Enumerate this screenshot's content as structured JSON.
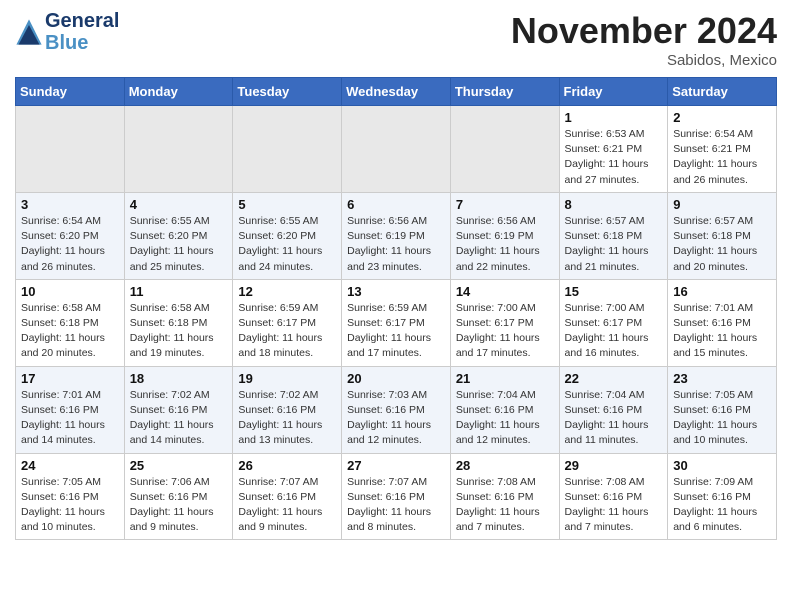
{
  "header": {
    "logo_line1": "General",
    "logo_line2": "Blue",
    "month": "November 2024",
    "location": "Sabidos, Mexico"
  },
  "weekdays": [
    "Sunday",
    "Monday",
    "Tuesday",
    "Wednesday",
    "Thursday",
    "Friday",
    "Saturday"
  ],
  "rows": [
    [
      {
        "day": "",
        "info": ""
      },
      {
        "day": "",
        "info": ""
      },
      {
        "day": "",
        "info": ""
      },
      {
        "day": "",
        "info": ""
      },
      {
        "day": "",
        "info": ""
      },
      {
        "day": "1",
        "info": "Sunrise: 6:53 AM\nSunset: 6:21 PM\nDaylight: 11 hours\nand 27 minutes."
      },
      {
        "day": "2",
        "info": "Sunrise: 6:54 AM\nSunset: 6:21 PM\nDaylight: 11 hours\nand 26 minutes."
      }
    ],
    [
      {
        "day": "3",
        "info": "Sunrise: 6:54 AM\nSunset: 6:20 PM\nDaylight: 11 hours\nand 26 minutes."
      },
      {
        "day": "4",
        "info": "Sunrise: 6:55 AM\nSunset: 6:20 PM\nDaylight: 11 hours\nand 25 minutes."
      },
      {
        "day": "5",
        "info": "Sunrise: 6:55 AM\nSunset: 6:20 PM\nDaylight: 11 hours\nand 24 minutes."
      },
      {
        "day": "6",
        "info": "Sunrise: 6:56 AM\nSunset: 6:19 PM\nDaylight: 11 hours\nand 23 minutes."
      },
      {
        "day": "7",
        "info": "Sunrise: 6:56 AM\nSunset: 6:19 PM\nDaylight: 11 hours\nand 22 minutes."
      },
      {
        "day": "8",
        "info": "Sunrise: 6:57 AM\nSunset: 6:18 PM\nDaylight: 11 hours\nand 21 minutes."
      },
      {
        "day": "9",
        "info": "Sunrise: 6:57 AM\nSunset: 6:18 PM\nDaylight: 11 hours\nand 20 minutes."
      }
    ],
    [
      {
        "day": "10",
        "info": "Sunrise: 6:58 AM\nSunset: 6:18 PM\nDaylight: 11 hours\nand 20 minutes."
      },
      {
        "day": "11",
        "info": "Sunrise: 6:58 AM\nSunset: 6:18 PM\nDaylight: 11 hours\nand 19 minutes."
      },
      {
        "day": "12",
        "info": "Sunrise: 6:59 AM\nSunset: 6:17 PM\nDaylight: 11 hours\nand 18 minutes."
      },
      {
        "day": "13",
        "info": "Sunrise: 6:59 AM\nSunset: 6:17 PM\nDaylight: 11 hours\nand 17 minutes."
      },
      {
        "day": "14",
        "info": "Sunrise: 7:00 AM\nSunset: 6:17 PM\nDaylight: 11 hours\nand 17 minutes."
      },
      {
        "day": "15",
        "info": "Sunrise: 7:00 AM\nSunset: 6:17 PM\nDaylight: 11 hours\nand 16 minutes."
      },
      {
        "day": "16",
        "info": "Sunrise: 7:01 AM\nSunset: 6:16 PM\nDaylight: 11 hours\nand 15 minutes."
      }
    ],
    [
      {
        "day": "17",
        "info": "Sunrise: 7:01 AM\nSunset: 6:16 PM\nDaylight: 11 hours\nand 14 minutes."
      },
      {
        "day": "18",
        "info": "Sunrise: 7:02 AM\nSunset: 6:16 PM\nDaylight: 11 hours\nand 14 minutes."
      },
      {
        "day": "19",
        "info": "Sunrise: 7:02 AM\nSunset: 6:16 PM\nDaylight: 11 hours\nand 13 minutes."
      },
      {
        "day": "20",
        "info": "Sunrise: 7:03 AM\nSunset: 6:16 PM\nDaylight: 11 hours\nand 12 minutes."
      },
      {
        "day": "21",
        "info": "Sunrise: 7:04 AM\nSunset: 6:16 PM\nDaylight: 11 hours\nand 12 minutes."
      },
      {
        "day": "22",
        "info": "Sunrise: 7:04 AM\nSunset: 6:16 PM\nDaylight: 11 hours\nand 11 minutes."
      },
      {
        "day": "23",
        "info": "Sunrise: 7:05 AM\nSunset: 6:16 PM\nDaylight: 11 hours\nand 10 minutes."
      }
    ],
    [
      {
        "day": "24",
        "info": "Sunrise: 7:05 AM\nSunset: 6:16 PM\nDaylight: 11 hours\nand 10 minutes."
      },
      {
        "day": "25",
        "info": "Sunrise: 7:06 AM\nSunset: 6:16 PM\nDaylight: 11 hours\nand 9 minutes."
      },
      {
        "day": "26",
        "info": "Sunrise: 7:07 AM\nSunset: 6:16 PM\nDaylight: 11 hours\nand 9 minutes."
      },
      {
        "day": "27",
        "info": "Sunrise: 7:07 AM\nSunset: 6:16 PM\nDaylight: 11 hours\nand 8 minutes."
      },
      {
        "day": "28",
        "info": "Sunrise: 7:08 AM\nSunset: 6:16 PM\nDaylight: 11 hours\nand 7 minutes."
      },
      {
        "day": "29",
        "info": "Sunrise: 7:08 AM\nSunset: 6:16 PM\nDaylight: 11 hours\nand 7 minutes."
      },
      {
        "day": "30",
        "info": "Sunrise: 7:09 AM\nSunset: 6:16 PM\nDaylight: 11 hours\nand 6 minutes."
      }
    ]
  ]
}
